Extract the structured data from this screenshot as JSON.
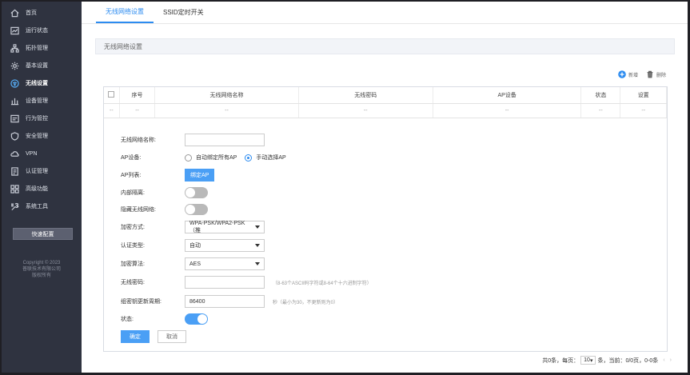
{
  "sidebar": {
    "items": [
      {
        "label": "首页",
        "icon": "home-icon"
      },
      {
        "label": "运行状态",
        "icon": "chart-icon"
      },
      {
        "label": "拓扑管理",
        "icon": "topology-icon"
      },
      {
        "label": "基本设置",
        "icon": "gear-icon"
      },
      {
        "label": "无线设置",
        "icon": "wireless-icon",
        "active": true
      },
      {
        "label": "设备管理",
        "icon": "device-icon"
      },
      {
        "label": "行为管控",
        "icon": "behavior-icon"
      },
      {
        "label": "安全管理",
        "icon": "shield-icon"
      },
      {
        "label": "VPN",
        "icon": "cloud-icon"
      },
      {
        "label": "认证管理",
        "icon": "auth-icon"
      },
      {
        "label": "高级功能",
        "icon": "grid-icon"
      },
      {
        "label": "系统工具",
        "icon": "tools-icon"
      }
    ],
    "quick_config": "快速配置",
    "copyright": [
      "Copyright © 2023",
      "普联技术有限公司",
      "版权所有"
    ]
  },
  "tabs": [
    {
      "label": "无线网络设置",
      "active": true
    },
    {
      "label": "SSID定时开关",
      "active": false
    }
  ],
  "section_title": "无线网络设置",
  "toolbar": {
    "add": "新增",
    "delete": "删除"
  },
  "table": {
    "headers": [
      "序号",
      "无线网络名称",
      "无线密码",
      "AP设备",
      "状态",
      "设置"
    ],
    "row": [
      "--",
      "--",
      "--",
      "--",
      "--",
      "--",
      "--"
    ]
  },
  "form": {
    "ssid_label": "无线网络名称:",
    "ssid_value": "",
    "ap_device_label": "AP设备:",
    "ap_option_all": "自动绑定所有AP",
    "ap_option_manual": "手动选择AP",
    "ap_list_label": "AP列表:",
    "bind_ap_button": "绑定AP",
    "isolation_label": "内部隔离:",
    "hide_ssid_label": "隐藏无线网络:",
    "encryption_label": "加密方式:",
    "encryption_value": "WPA-PSK/WPA2-PSK（推",
    "auth_label": "认证类型:",
    "auth_value": "自动",
    "cipher_label": "加密算法:",
    "cipher_value": "AES",
    "password_label": "无线密码:",
    "password_value": "",
    "password_hint": "（8-63个ASCII码字符或8-64个十六进制字符）",
    "rekey_label": "组密钥更新周期:",
    "rekey_value": "86400",
    "rekey_hint": "秒（最小为30，不更新则为0）",
    "status_label": "状态:",
    "ok_button": "确定",
    "cancel_button": "取消"
  },
  "pager": {
    "total": "共0条，每页：",
    "per_page": "10",
    "unit": "条，当前：0/0页，0-0条"
  }
}
